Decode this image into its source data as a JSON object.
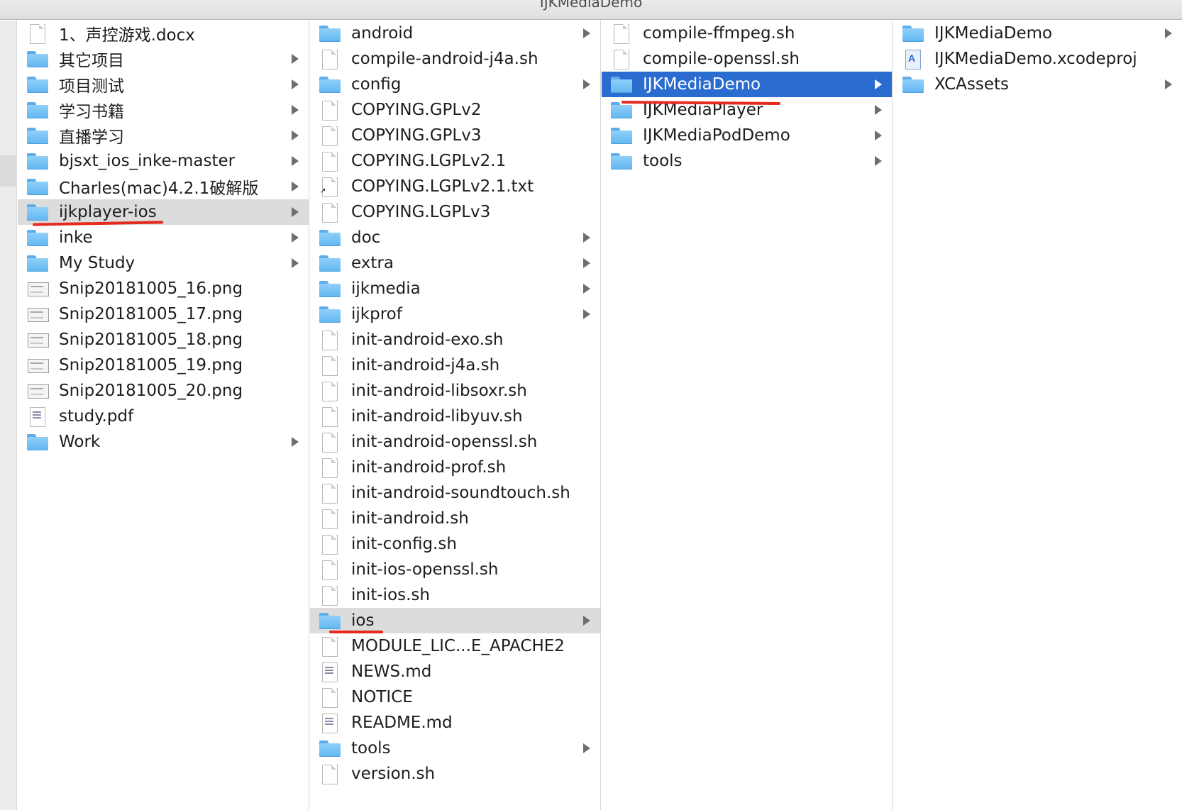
{
  "window": {
    "title": "IJKMediaDemo"
  },
  "columns": [
    {
      "items": [
        {
          "name": "1、声控游戏.docx",
          "icon": "doc-icon",
          "has_children": false
        },
        {
          "name": "其它项目",
          "icon": "folder-icon",
          "has_children": true
        },
        {
          "name": "项目测试",
          "icon": "folder-icon",
          "has_children": true
        },
        {
          "name": "学习书籍",
          "icon": "folder-icon",
          "has_children": true
        },
        {
          "name": "直播学习",
          "icon": "folder-icon",
          "has_children": true
        },
        {
          "name": "bjsxt_ios_inke-master",
          "icon": "folder-icon",
          "has_children": true
        },
        {
          "name": "Charles(mac)4.2.1破解版",
          "icon": "folder-icon",
          "has_children": true
        },
        {
          "name": "ijkplayer-ios",
          "icon": "folder-icon",
          "has_children": true,
          "selected": "inactive"
        },
        {
          "name": "inke",
          "icon": "folder-icon",
          "has_children": true
        },
        {
          "name": "My Study",
          "icon": "folder-icon",
          "has_children": true
        },
        {
          "name": "Snip20181005_16.png",
          "icon": "image-icon",
          "has_children": false
        },
        {
          "name": "Snip20181005_17.png",
          "icon": "image-icon",
          "has_children": false
        },
        {
          "name": "Snip20181005_18.png",
          "icon": "image-icon",
          "has_children": false
        },
        {
          "name": "Snip20181005_19.png",
          "icon": "image-icon",
          "has_children": false
        },
        {
          "name": "Snip20181005_20.png",
          "icon": "image-icon",
          "has_children": false
        },
        {
          "name": "study.pdf",
          "icon": "text-icon",
          "has_children": false
        },
        {
          "name": "Work",
          "icon": "folder-icon",
          "has_children": true
        }
      ]
    },
    {
      "items": [
        {
          "name": "android",
          "icon": "folder-icon",
          "has_children": true
        },
        {
          "name": "compile-android-j4a.sh",
          "icon": "doc-icon",
          "has_children": false
        },
        {
          "name": "config",
          "icon": "folder-icon",
          "has_children": true
        },
        {
          "name": "COPYING.GPLv2",
          "icon": "doc-icon",
          "has_children": false
        },
        {
          "name": "COPYING.GPLv3",
          "icon": "doc-icon",
          "has_children": false
        },
        {
          "name": "COPYING.LGPLv2.1",
          "icon": "doc-icon",
          "has_children": false
        },
        {
          "name": "COPYING.LGPLv2.1.txt",
          "icon": "alias-icon",
          "has_children": false
        },
        {
          "name": "COPYING.LGPLv3",
          "icon": "doc-icon",
          "has_children": false
        },
        {
          "name": "doc",
          "icon": "folder-icon",
          "has_children": true
        },
        {
          "name": "extra",
          "icon": "folder-icon",
          "has_children": true
        },
        {
          "name": "ijkmedia",
          "icon": "folder-icon",
          "has_children": true
        },
        {
          "name": "ijkprof",
          "icon": "folder-icon",
          "has_children": true
        },
        {
          "name": "init-android-exo.sh",
          "icon": "doc-icon",
          "has_children": false
        },
        {
          "name": "init-android-j4a.sh",
          "icon": "doc-icon",
          "has_children": false
        },
        {
          "name": "init-android-libsoxr.sh",
          "icon": "doc-icon",
          "has_children": false
        },
        {
          "name": "init-android-libyuv.sh",
          "icon": "doc-icon",
          "has_children": false
        },
        {
          "name": "init-android-openssl.sh",
          "icon": "doc-icon",
          "has_children": false
        },
        {
          "name": "init-android-prof.sh",
          "icon": "doc-icon",
          "has_children": false
        },
        {
          "name": "init-android-soundtouch.sh",
          "icon": "doc-icon",
          "has_children": false
        },
        {
          "name": "init-android.sh",
          "icon": "doc-icon",
          "has_children": false
        },
        {
          "name": "init-config.sh",
          "icon": "doc-icon",
          "has_children": false
        },
        {
          "name": "init-ios-openssl.sh",
          "icon": "doc-icon",
          "has_children": false
        },
        {
          "name": "init-ios.sh",
          "icon": "doc-icon",
          "has_children": false
        },
        {
          "name": "ios",
          "icon": "folder-icon",
          "has_children": true,
          "selected": "inactive"
        },
        {
          "name": "MODULE_LIC...E_APACHE2",
          "icon": "doc-icon",
          "has_children": false
        },
        {
          "name": "NEWS.md",
          "icon": "text-icon",
          "has_children": false
        },
        {
          "name": "NOTICE",
          "icon": "doc-icon",
          "has_children": false
        },
        {
          "name": "README.md",
          "icon": "text-icon",
          "has_children": false
        },
        {
          "name": "tools",
          "icon": "folder-icon",
          "has_children": true
        },
        {
          "name": "version.sh",
          "icon": "doc-icon",
          "has_children": false
        }
      ]
    },
    {
      "items": [
        {
          "name": "compile-ffmpeg.sh",
          "icon": "doc-icon",
          "has_children": false
        },
        {
          "name": "compile-openssl.sh",
          "icon": "doc-icon",
          "has_children": false
        },
        {
          "name": "IJKMediaDemo",
          "icon": "folder-icon",
          "has_children": true,
          "selected": "active"
        },
        {
          "name": "IJKMediaPlayer",
          "icon": "folder-icon",
          "has_children": true
        },
        {
          "name": "IJKMediaPodDemo",
          "icon": "folder-icon",
          "has_children": true
        },
        {
          "name": "tools",
          "icon": "folder-icon",
          "has_children": true
        }
      ]
    },
    {
      "items": [
        {
          "name": "IJKMediaDemo",
          "icon": "folder-icon",
          "has_children": true
        },
        {
          "name": "IJKMediaDemo.xcodeproj",
          "icon": "xcode-icon",
          "has_children": false
        },
        {
          "name": "XCAssets",
          "icon": "folder-icon",
          "has_children": true
        }
      ]
    }
  ],
  "colors": {
    "active_selection": "#2a6ccf",
    "inactive_selection": "#dcdcdc",
    "annotation_underline": "#e52a1f",
    "folder": "#62b6f1"
  }
}
